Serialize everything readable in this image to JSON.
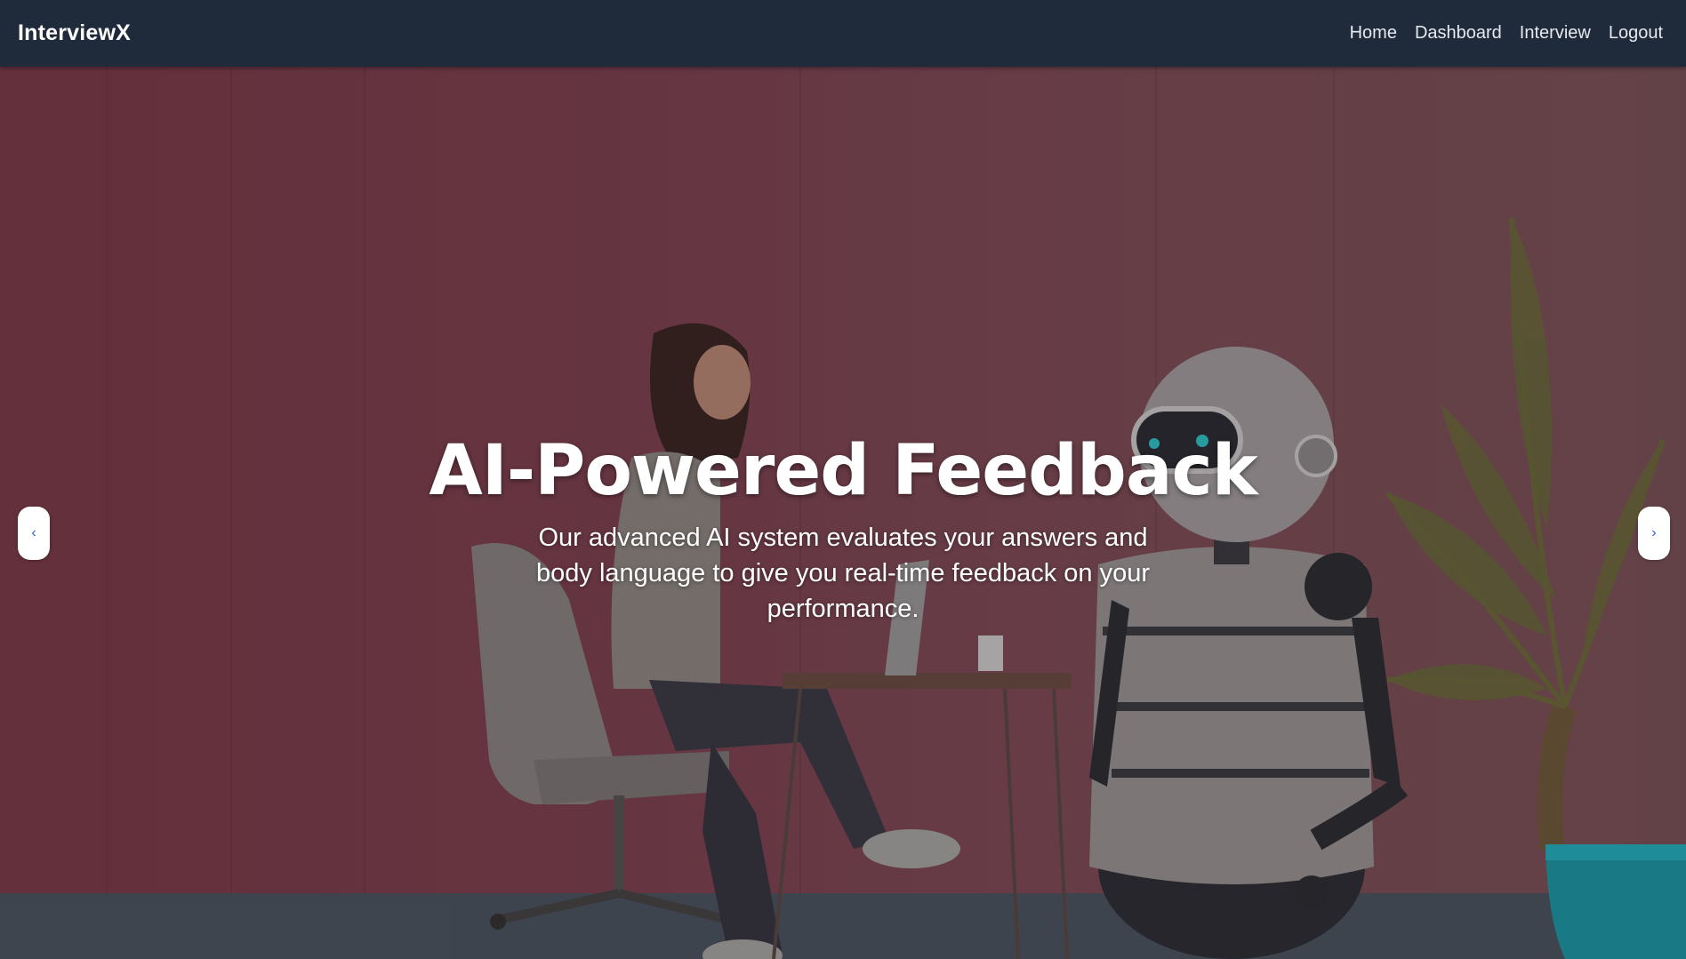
{
  "navbar": {
    "brand": "InterviewX",
    "links": [
      "Home",
      "Dashboard",
      "Interview",
      "Logout"
    ]
  },
  "hero": {
    "title": "AI-Powered Feedback",
    "description": "Our advanced AI system evaluates your answers and body language to give you real-time feedback on your performance.",
    "prev_icon": "chevron-left-icon",
    "next_icon": "chevron-right-icon",
    "prev_glyph": "‹",
    "next_glyph": "›"
  }
}
